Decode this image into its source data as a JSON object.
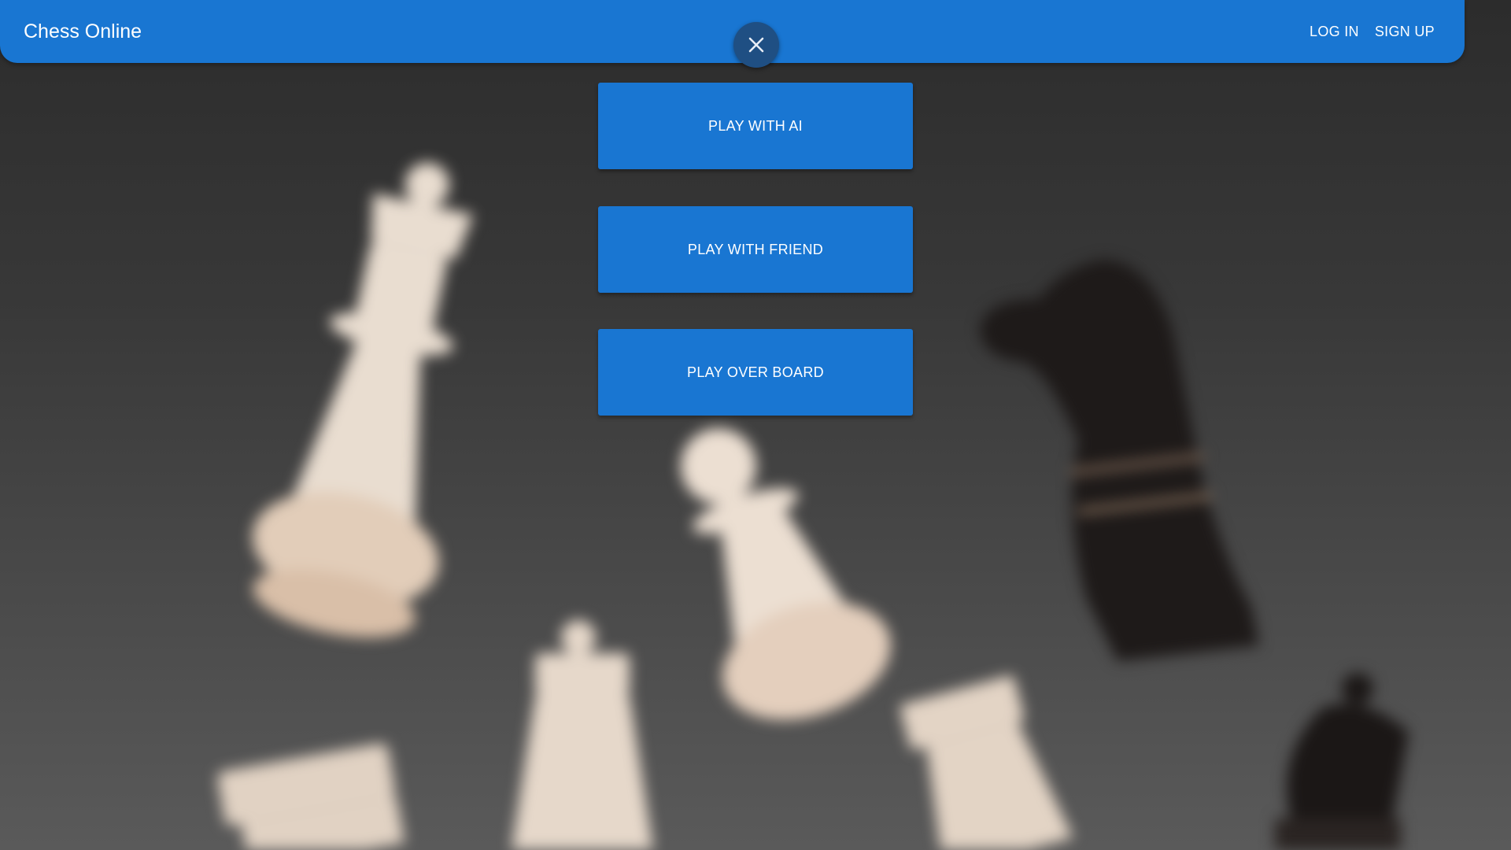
{
  "app": {
    "title": "Chess Online"
  },
  "nav": {
    "login_label": "LOG IN",
    "signup_label": "SIGN UP"
  },
  "menu": {
    "close_icon": "close-icon",
    "options": [
      {
        "label": "PLAY WITH AI"
      },
      {
        "label": "PLAY WITH FRIEND"
      },
      {
        "label": "PLAY OVER BOARD"
      }
    ]
  },
  "colors": {
    "primary": "#1976d2",
    "close_button": "#1f4f83",
    "background": "#3a3a3a",
    "text_on_primary": "#ffffff"
  }
}
